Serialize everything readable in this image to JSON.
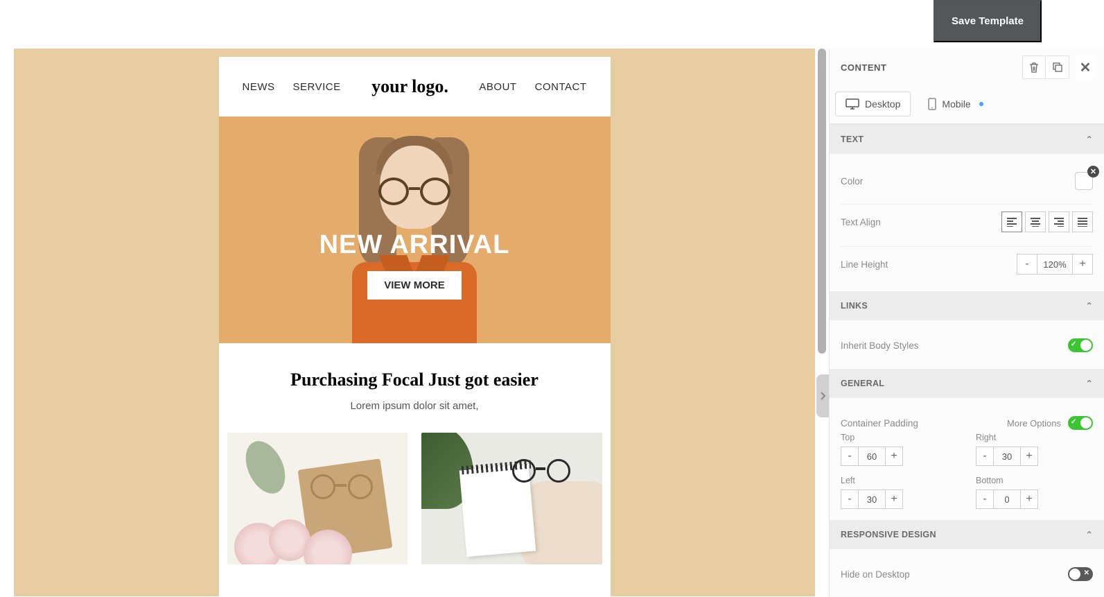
{
  "topbar": {
    "save_label": "Save Template"
  },
  "canvas": {
    "nav": {
      "news": "NEWS",
      "service": "SERVICE",
      "about": "ABOUT",
      "contact": "CONTACT"
    },
    "logo": "your logo.",
    "hero": {
      "title": "NEW ARRIVAL",
      "cta": "VIEW MORE"
    },
    "section": {
      "heading": "Purchasing Focal Just got easier",
      "subtext": "Lorem ipsum dolor sit amet,"
    }
  },
  "sidebar": {
    "header": "CONTENT",
    "tabs": {
      "desktop": "Desktop",
      "mobile": "Mobile"
    },
    "sections": {
      "text": {
        "title": "TEXT",
        "color_label": "Color",
        "align_label": "Text Align",
        "lineheight_label": "Line Height",
        "lineheight_value": "120%"
      },
      "links": {
        "title": "LINKS",
        "inherit_label": "Inherit Body Styles",
        "inherit_on": true
      },
      "general": {
        "title": "GENERAL",
        "padding_label": "Container Padding",
        "more_options": "More Options",
        "more_on": true,
        "padding": {
          "top": {
            "label": "Top",
            "value": "60"
          },
          "right": {
            "label": "Right",
            "value": "30"
          },
          "left": {
            "label": "Left",
            "value": "30"
          },
          "bottom": {
            "label": "Bottom",
            "value": "0"
          }
        }
      },
      "responsive": {
        "title": "RESPONSIVE DESIGN",
        "hide_label": "Hide on Desktop",
        "hide_on": false
      }
    }
  }
}
